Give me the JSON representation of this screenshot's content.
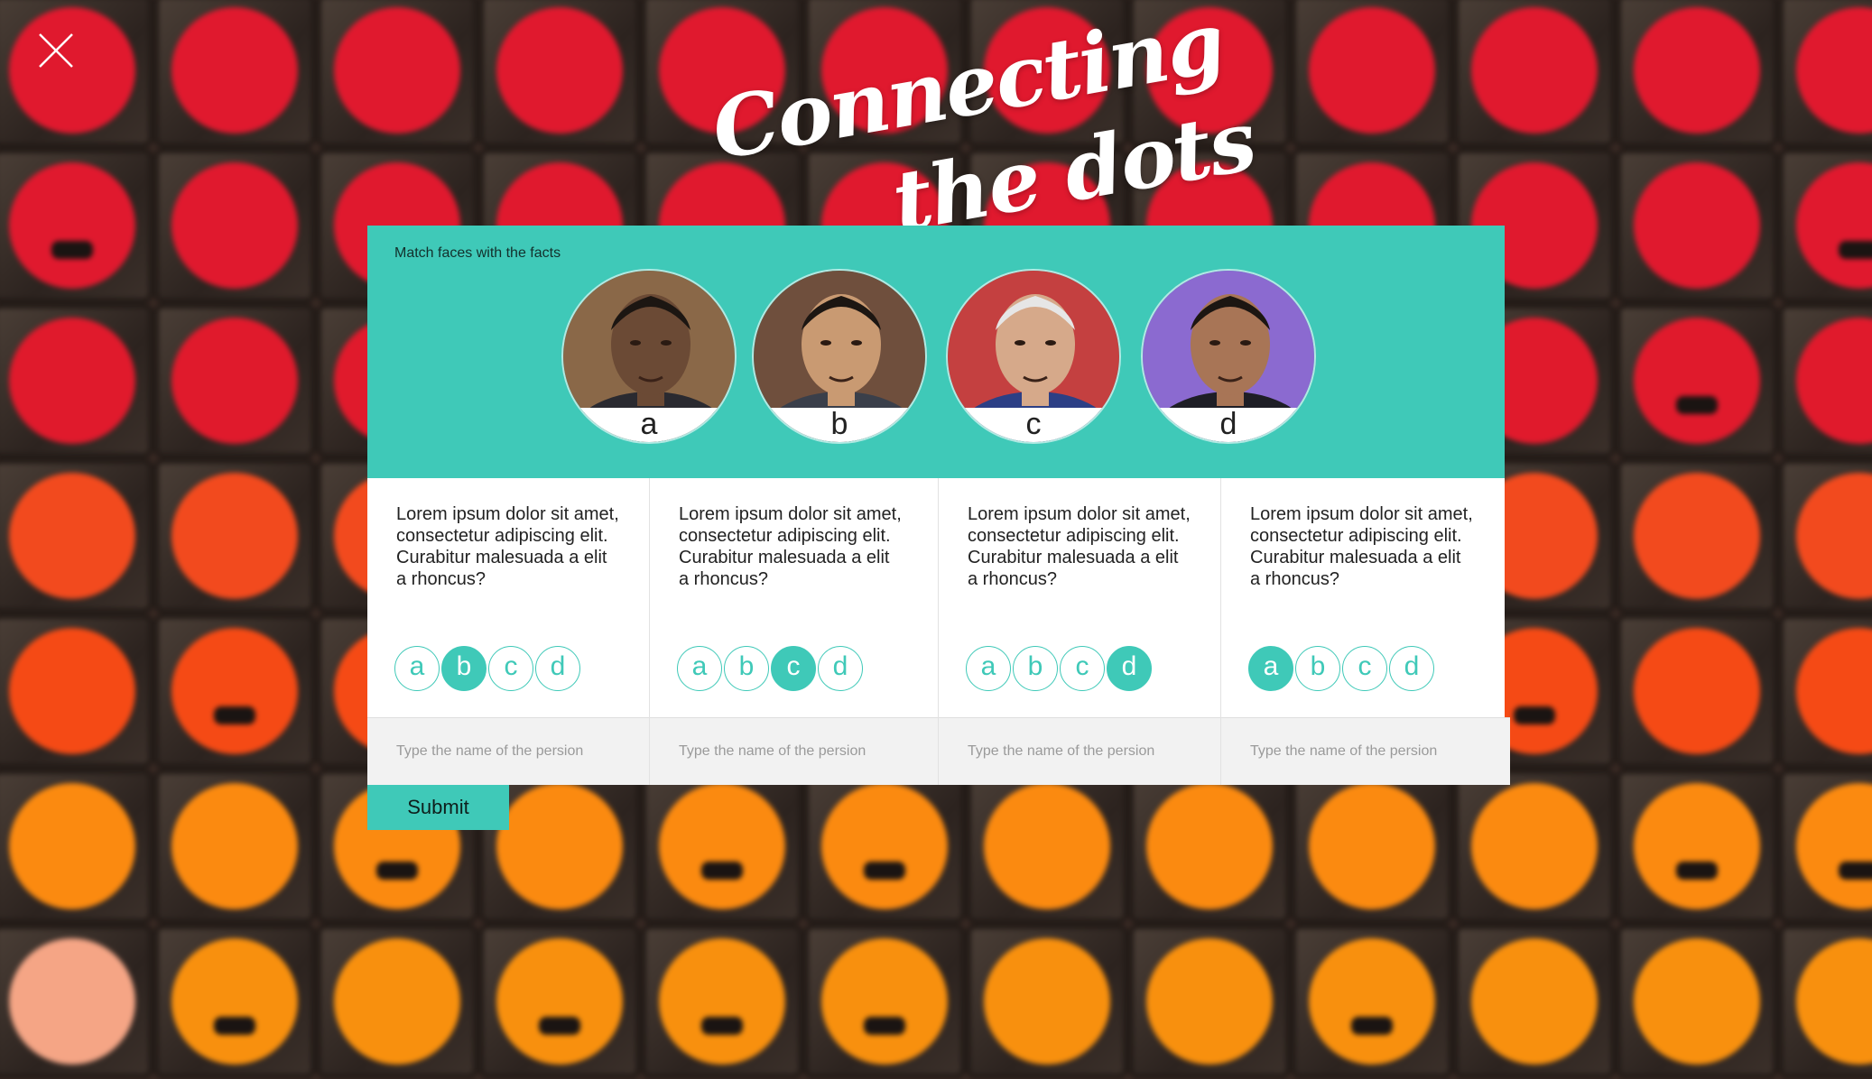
{
  "title": {
    "line1": "Connecting",
    "line2": "the dots"
  },
  "quiz": {
    "instructions": "Match faces with the facts",
    "faces": [
      {
        "letter": "a",
        "bg": "#8a6848",
        "skin": "#6b4a35",
        "shirt": "#2a2a30"
      },
      {
        "letter": "b",
        "bg": "#6f4f3d",
        "skin": "#c99a72",
        "shirt": "#3a3f4a"
      },
      {
        "letter": "c",
        "bg": "#c44040",
        "skin": "#d6a98a",
        "shirt": "#2c3f85"
      },
      {
        "letter": "d",
        "bg": "#8b6ad0",
        "skin": "#a87556",
        "shirt": "#1e1e26"
      }
    ],
    "questions": [
      {
        "text": "Lorem ipsum dolor sit amet, consectetur adipiscing elit. Curabitur malesuada a elit a rhoncus?",
        "options": [
          "a",
          "b",
          "c",
          "d"
        ],
        "selected": "b",
        "placeholder": "Type the name of the persion"
      },
      {
        "text": "Lorem ipsum dolor sit amet, consectetur adipiscing elit. Curabitur malesuada a elit a rhoncus?",
        "options": [
          "a",
          "b",
          "c",
          "d"
        ],
        "selected": "c",
        "placeholder": "Type the name of the persion"
      },
      {
        "text": "Lorem ipsum dolor sit amet, consectetur adipiscing elit. Curabitur malesuada a elit a rhoncus?",
        "options": [
          "a",
          "b",
          "c",
          "d"
        ],
        "selected": "d",
        "placeholder": "Type the name of the persion"
      },
      {
        "text": "Lorem ipsum dolor sit amet, consectetur adipiscing elit. Curabitur malesuada a elit a rhoncus?",
        "options": [
          "a",
          "b",
          "c",
          "d"
        ],
        "selected": "a",
        "placeholder": "Type the name of the persion"
      }
    ],
    "submit_label": "Submit"
  },
  "colors": {
    "accent": "#3fc9b8",
    "dot_rows": [
      "#e0192e",
      "#e0192e",
      "#e01a2c",
      "#f24a1e",
      "#f54a15",
      "#fb8a10",
      "#f8900e"
    ]
  },
  "icons": {
    "close": "close-icon"
  }
}
